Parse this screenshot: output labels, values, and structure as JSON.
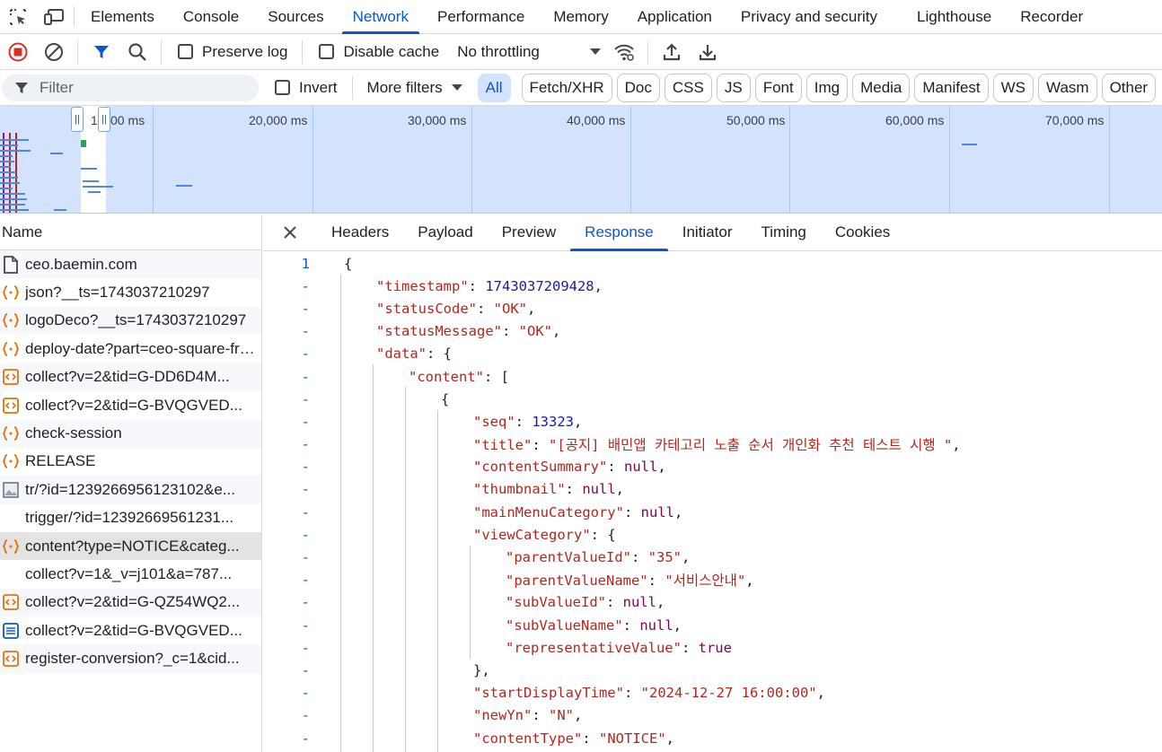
{
  "main_tabs": [
    "Elements",
    "Console",
    "Sources",
    "Network",
    "Performance",
    "Memory",
    "Application",
    "Privacy and security",
    "Lighthouse",
    "Recorder"
  ],
  "active_main_tab": "Network",
  "toolbar": {
    "preserve_log": "Preserve log",
    "disable_cache": "Disable cache",
    "throttling": "No throttling"
  },
  "filterbar": {
    "placeholder": "Filter",
    "invert": "Invert",
    "more_filters": "More filters",
    "types": [
      "All",
      "Fetch/XHR",
      "Doc",
      "CSS",
      "JS",
      "Font",
      "Img",
      "Media",
      "Manifest",
      "WS",
      "Wasm",
      "Other"
    ]
  },
  "overview": {
    "labels": [
      "1",
      "00 ms",
      "20,000 ms",
      "30,000 ms",
      "40,000 ms",
      "50,000 ms",
      "60,000 ms",
      "70,000 ms"
    ]
  },
  "name_list": {
    "header": "Name",
    "rows": [
      {
        "name": "ceo.baemin.com",
        "icon": "document-icon"
      },
      {
        "name": "json?__ts=1743037210297",
        "icon": "fetch-icon"
      },
      {
        "name": "logoDeco?__ts=1743037210297",
        "icon": "fetch-icon"
      },
      {
        "name": "deploy-date?part=ceo-square-front",
        "icon": "fetch-icon"
      },
      {
        "name": "collect?v=2&tid=G-DD6D4M...",
        "icon": "script-icon"
      },
      {
        "name": "collect?v=2&tid=G-BVQGVED...",
        "icon": "script-icon"
      },
      {
        "name": "check-session",
        "icon": "fetch-icon"
      },
      {
        "name": "RELEASE",
        "icon": "fetch-icon"
      },
      {
        "name": "tr/?id=1239266956123102&e...",
        "icon": "image-icon"
      },
      {
        "name": "trigger/?id=12392669561231...",
        "icon": "none"
      },
      {
        "name": "content?type=NOTICE&categ...",
        "icon": "fetch-icon"
      },
      {
        "name": "collect?v=1&_v=j101&a=787...",
        "icon": "none"
      },
      {
        "name": "collect?v=2&tid=G-QZ54WQ2...",
        "icon": "script-icon"
      },
      {
        "name": "collect?v=2&tid=G-BVQGVED...",
        "icon": "text-icon"
      },
      {
        "name": "register-conversion?_c=1&cid...",
        "icon": "script-icon"
      }
    ],
    "selected_index": 10
  },
  "detail_tabs": [
    "Headers",
    "Payload",
    "Preview",
    "Response",
    "Initiator",
    "Timing",
    "Cookies"
  ],
  "active_detail_tab": "Response",
  "response_lines": [
    {
      "g": "1",
      "indent": 0,
      "parts": [
        [
          "p",
          "{"
        ]
      ]
    },
    {
      "g": "-",
      "indent": 1,
      "parts": [
        [
          "k",
          "\"timestamp\""
        ],
        [
          "p",
          ": "
        ],
        [
          "n",
          "1743037209428"
        ],
        [
          "p",
          ","
        ]
      ]
    },
    {
      "g": "-",
      "indent": 1,
      "parts": [
        [
          "k",
          "\"statusCode\""
        ],
        [
          "p",
          ": "
        ],
        [
          "s",
          "\"OK\""
        ],
        [
          "p",
          ","
        ]
      ]
    },
    {
      "g": "-",
      "indent": 1,
      "parts": [
        [
          "k",
          "\"statusMessage\""
        ],
        [
          "p",
          ": "
        ],
        [
          "s",
          "\"OK\""
        ],
        [
          "p",
          ","
        ]
      ]
    },
    {
      "g": "-",
      "indent": 1,
      "parts": [
        [
          "k",
          "\"data\""
        ],
        [
          "p",
          ": {"
        ]
      ]
    },
    {
      "g": "-",
      "indent": 2,
      "parts": [
        [
          "k",
          "\"content\""
        ],
        [
          "p",
          ": ["
        ]
      ]
    },
    {
      "g": "-",
      "indent": 3,
      "parts": [
        [
          "p",
          "{"
        ]
      ]
    },
    {
      "g": "-",
      "indent": 4,
      "parts": [
        [
          "k",
          "\"seq\""
        ],
        [
          "p",
          ": "
        ],
        [
          "n",
          "13323"
        ],
        [
          "p",
          ","
        ]
      ]
    },
    {
      "g": "-",
      "indent": 4,
      "parts": [
        [
          "k",
          "\"title\""
        ],
        [
          "p",
          ": "
        ],
        [
          "s",
          "\"[공지] 배민앱 카테고리 노출 순서 개인화 추천 테스트 시행 \""
        ],
        [
          "p",
          ","
        ]
      ]
    },
    {
      "g": "-",
      "indent": 4,
      "parts": [
        [
          "k",
          "\"contentSummary\""
        ],
        [
          "p",
          ": "
        ],
        [
          "nl",
          "null"
        ],
        [
          "p",
          ","
        ]
      ]
    },
    {
      "g": "-",
      "indent": 4,
      "parts": [
        [
          "k",
          "\"thumbnail\""
        ],
        [
          "p",
          ": "
        ],
        [
          "nl",
          "null"
        ],
        [
          "p",
          ","
        ]
      ]
    },
    {
      "g": "-",
      "indent": 4,
      "parts": [
        [
          "k",
          "\"mainMenuCategory\""
        ],
        [
          "p",
          ": "
        ],
        [
          "nl",
          "null"
        ],
        [
          "p",
          ","
        ]
      ]
    },
    {
      "g": "-",
      "indent": 4,
      "parts": [
        [
          "k",
          "\"viewCategory\""
        ],
        [
          "p",
          ": {"
        ]
      ]
    },
    {
      "g": "-",
      "indent": 5,
      "parts": [
        [
          "k",
          "\"parentValueId\""
        ],
        [
          "p",
          ": "
        ],
        [
          "s",
          "\"35\""
        ],
        [
          "p",
          ","
        ]
      ]
    },
    {
      "g": "-",
      "indent": 5,
      "parts": [
        [
          "k",
          "\"parentValueName\""
        ],
        [
          "p",
          ": "
        ],
        [
          "s",
          "\"서비스안내\""
        ],
        [
          "p",
          ","
        ]
      ]
    },
    {
      "g": "-",
      "indent": 5,
      "parts": [
        [
          "k",
          "\"subValueId\""
        ],
        [
          "p",
          ": "
        ],
        [
          "nl",
          "null"
        ],
        [
          "p",
          ","
        ]
      ]
    },
    {
      "g": "-",
      "indent": 5,
      "parts": [
        [
          "k",
          "\"subValueName\""
        ],
        [
          "p",
          ": "
        ],
        [
          "nl",
          "null"
        ],
        [
          "p",
          ","
        ]
      ]
    },
    {
      "g": "-",
      "indent": 5,
      "parts": [
        [
          "k",
          "\"representativeValue\""
        ],
        [
          "p",
          ": "
        ],
        [
          "nl",
          "true"
        ]
      ]
    },
    {
      "g": "-",
      "indent": 4,
      "parts": [
        [
          "p",
          "},"
        ]
      ]
    },
    {
      "g": "-",
      "indent": 4,
      "parts": [
        [
          "k",
          "\"startDisplayTime\""
        ],
        [
          "p",
          ": "
        ],
        [
          "s",
          "\"2024-12-27 16:00:00\""
        ],
        [
          "p",
          ","
        ]
      ]
    },
    {
      "g": "-",
      "indent": 4,
      "parts": [
        [
          "k",
          "\"newYn\""
        ],
        [
          "p",
          ": "
        ],
        [
          "s",
          "\"N\""
        ],
        [
          "p",
          ","
        ]
      ]
    },
    {
      "g": "-",
      "indent": 4,
      "parts": [
        [
          "k",
          "\"contentType\""
        ],
        [
          "p",
          ": "
        ],
        [
          "s",
          "\"NOTICE\""
        ],
        [
          "p",
          ","
        ]
      ]
    }
  ],
  "colors": {
    "accent": "#0b57d0",
    "record": "#d93025",
    "json_key": "#b3261e",
    "json_number": "#1a1aa6",
    "json_literal": "#7f0055"
  }
}
